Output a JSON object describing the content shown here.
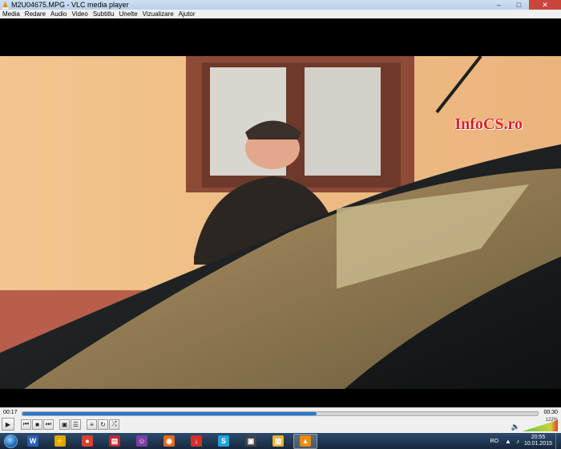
{
  "window": {
    "title": "M2U04675.MPG - VLC media player",
    "app_icon": "vlc-cone-icon",
    "minimize_icon": "minimize-icon",
    "maximize_icon": "maximize-icon",
    "close_icon": "close-icon"
  },
  "menu": [
    "Media",
    "Redare",
    "Audio",
    "Video",
    "Subtitlu",
    "Unelte",
    "Vizualizare",
    "Ajutor"
  ],
  "video": {
    "watermark": "InfoCS.ro",
    "watermark_color": "#d71f22"
  },
  "playback": {
    "current_time": "00:17",
    "total_time": "00:30",
    "progress_fraction": 0.57
  },
  "controls": {
    "play_icon": "play-icon",
    "prev_icon": "previous-icon",
    "stop_icon": "stop-icon",
    "next_icon": "next-icon",
    "fullscreen_icon": "fullscreen-icon",
    "extended_icon": "equalizer-icon",
    "playlist_icon": "playlist-icon",
    "loop_icon": "loop-icon",
    "shuffle_icon": "shuffle-icon",
    "volume_level": "122%",
    "volume_fraction": 1.0
  },
  "taskbar": {
    "apps": [
      {
        "name": "word",
        "icon": "word-icon",
        "color": "#2b5fb4",
        "glyph": "W"
      },
      {
        "name": "winamp",
        "icon": "winamp-icon",
        "color": "#e0a500",
        "glyph": "⚡"
      },
      {
        "name": "chrome",
        "icon": "chrome-icon",
        "color": "#d9422e",
        "glyph": "●"
      },
      {
        "name": "pdf",
        "icon": "pdf-icon",
        "color": "#c4262e",
        "glyph": "▤"
      },
      {
        "name": "messenger",
        "icon": "messenger-icon",
        "color": "#7b3fa5",
        "glyph": "☺"
      },
      {
        "name": "firefox",
        "icon": "firefox-icon",
        "color": "#e66a1c",
        "glyph": "◉"
      },
      {
        "name": "downloader",
        "icon": "download-icon",
        "color": "#d4302b",
        "glyph": "↓"
      },
      {
        "name": "skype",
        "icon": "skype-icon",
        "color": "#1fa3dd",
        "glyph": "S"
      },
      {
        "name": "camera",
        "icon": "camera-icon",
        "color": "#444",
        "glyph": "▣"
      },
      {
        "name": "explorer",
        "icon": "folder-icon",
        "color": "#e3b43c",
        "glyph": "▥"
      },
      {
        "name": "vlc",
        "icon": "vlc-icon",
        "color": "#f08a00",
        "glyph": "▲"
      }
    ],
    "active_index": 10,
    "lang": "RO",
    "time": "20:55",
    "date": "10.01.2015"
  }
}
